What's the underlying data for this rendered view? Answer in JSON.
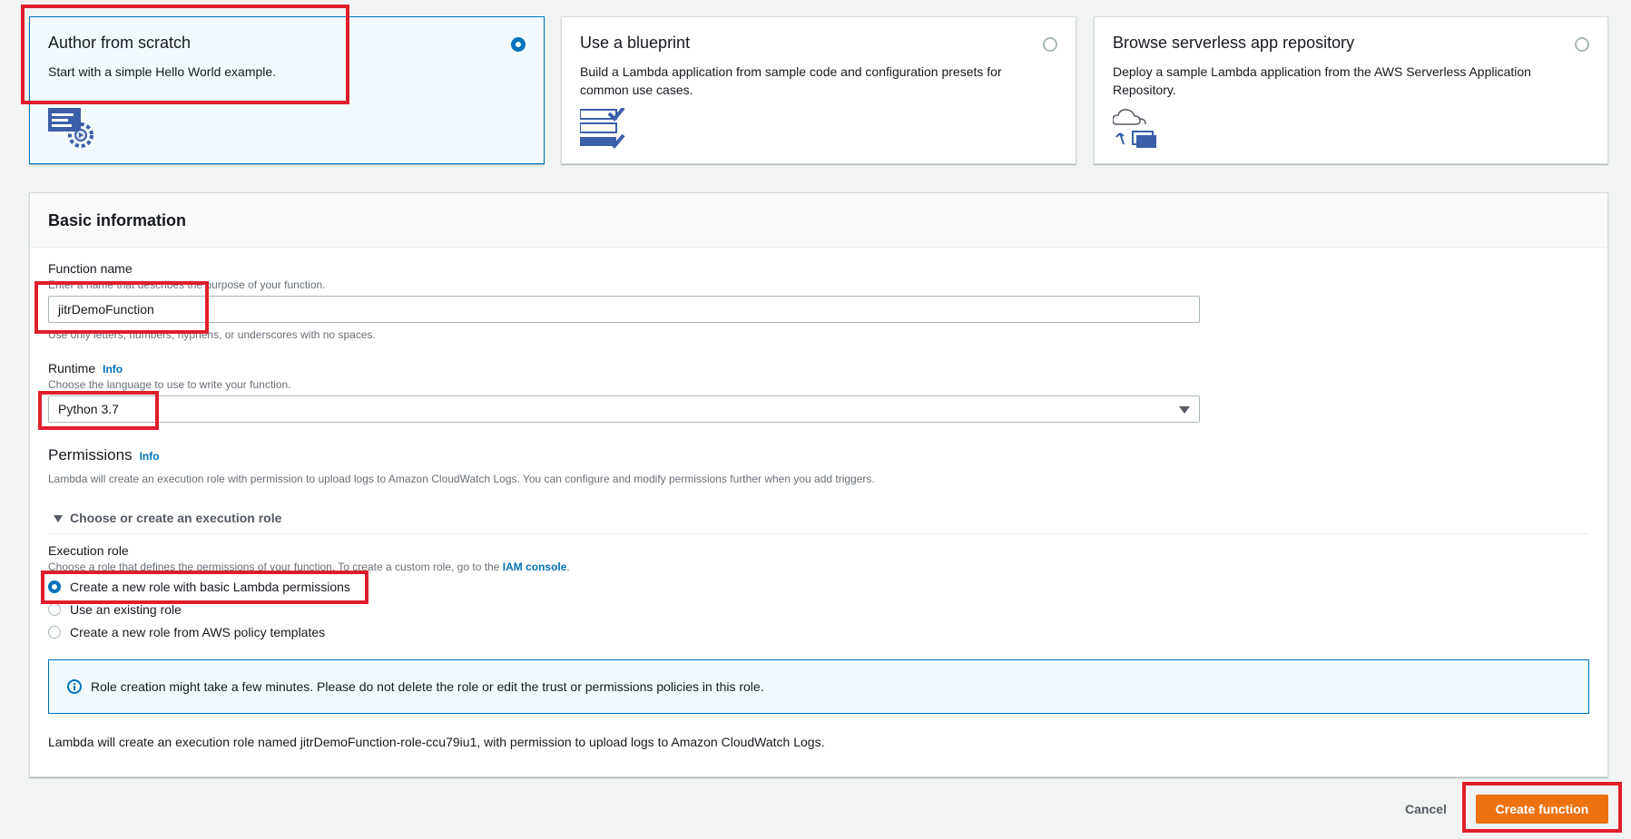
{
  "cards": [
    {
      "title": "Author from scratch",
      "desc": "Start with a simple Hello World example.",
      "selected": true
    },
    {
      "title": "Use a blueprint",
      "desc": "Build a Lambda application from sample code and configuration presets for common use cases.",
      "selected": false
    },
    {
      "title": "Browse serverless app repository",
      "desc": "Deploy a sample Lambda application from the AWS Serverless Application Repository.",
      "selected": false
    }
  ],
  "basic": {
    "header": "Basic information",
    "function_name_label": "Function name",
    "function_name_hint": "Enter a name that describes the purpose of your function.",
    "function_name_value": "jitrDemoFunction",
    "function_name_constraint": "Use only letters, numbers, hyphens, or underscores with no spaces.",
    "runtime_label": "Runtime",
    "info": "Info",
    "runtime_hint": "Choose the language to use to write your function.",
    "runtime_value": "Python 3.7",
    "permissions_label": "Permissions",
    "permissions_desc": "Lambda will create an execution role with permission to upload logs to Amazon CloudWatch Logs. You can configure and modify permissions further when you add triggers.",
    "exec_section": "Choose or create an execution role",
    "exec_role_label": "Execution role",
    "exec_role_hint": "Choose a role that defines the permissions of your function. To create a custom role, go to the",
    "exec_role_link": "IAM console",
    "exec_role_period": ".",
    "options": [
      {
        "label": "Create a new role with basic Lambda permissions",
        "selected": true
      },
      {
        "label": "Use an existing role",
        "selected": false
      },
      {
        "label": "Create a new role from AWS policy templates",
        "selected": false
      }
    ],
    "alert": "Role creation might take a few minutes. Please do not delete the role or edit the trust or permissions policies in this role.",
    "footer_note": "Lambda will create an execution role named jitrDemoFunction-role-ccu79iu1, with permission to upload logs to Amazon CloudWatch Logs."
  },
  "actions": {
    "cancel": "Cancel",
    "create": "Create function"
  },
  "colors": {
    "accent": "#0073bb",
    "primary_button": "#ec7211",
    "highlight": "#e01e2b"
  }
}
